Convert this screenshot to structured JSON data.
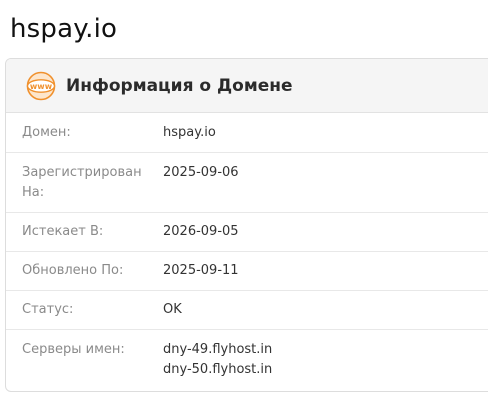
{
  "page": {
    "title": "hspay.io"
  },
  "card": {
    "icon": "www-globe-icon",
    "icon_color": "#f0912e",
    "header_title": "Информация о Домене"
  },
  "rows": {
    "domain": {
      "label": "Домен:",
      "value": "hspay.io"
    },
    "registered": {
      "label": "Зарегистрирован На:",
      "value": "2025-09-06"
    },
    "expires": {
      "label": "Истекает В:",
      "value": "2026-09-05"
    },
    "updated": {
      "label": "Обновлено По:",
      "value": "2025-09-11"
    },
    "status": {
      "label": "Статус:",
      "value": "OK"
    },
    "nameservers": {
      "label": "Серверы имен:",
      "values": [
        "dny-49.flyhost.in",
        "dny-50.flyhost.in"
      ]
    }
  }
}
